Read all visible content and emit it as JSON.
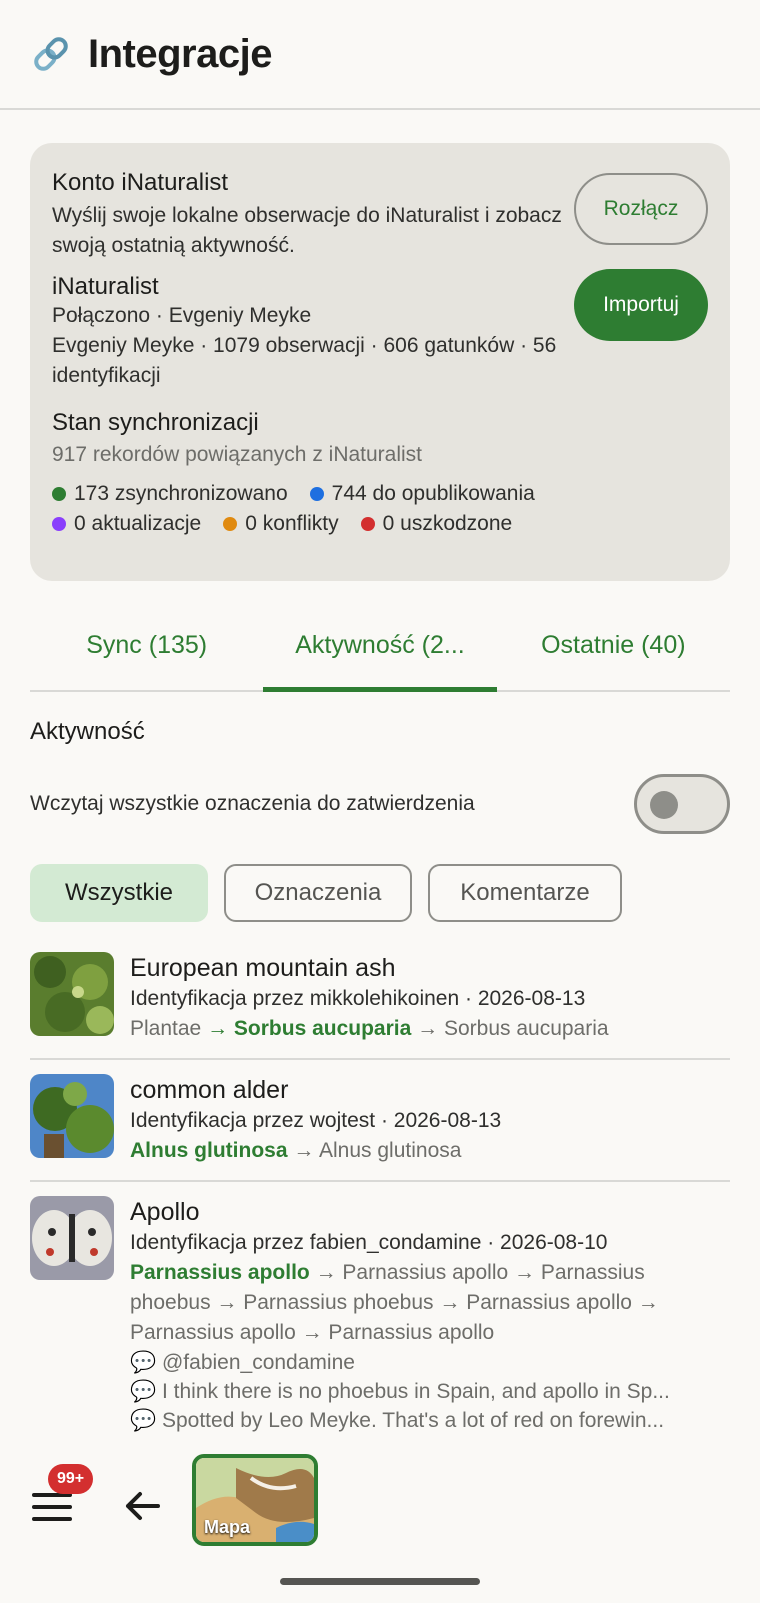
{
  "header": {
    "title": "Integracje",
    "icon": "link-icon"
  },
  "account": {
    "heading": "Konto iNaturalist",
    "description": "Wyślij swoje lokalne obserwacje do iNaturalist i zobacz swoją ostatnią aktywność.",
    "service": "iNaturalist",
    "status": "Połączono · Evgeniy Meyke",
    "stats": "Evgeniy Meyke · 1079 obserwacji · 606 gatunków · 56 identyfikacji",
    "disconnect_label": "Rozłącz",
    "import_label": "Importuj",
    "sync_heading": "Stan synchronizacji",
    "sync_summary": "917 rekordów powiązanych z iNaturalist",
    "legend": [
      {
        "label": "173 zsynchronizowano",
        "color": "#2e7d32"
      },
      {
        "label": "744 do opublikowania",
        "color": "#1e6fe0"
      },
      {
        "label": "0 aktualizacje",
        "color": "#8a3ffc"
      },
      {
        "label": "0 konflikty",
        "color": "#e08a10"
      },
      {
        "label": "0 uszkodzone",
        "color": "#d32f2f"
      }
    ]
  },
  "tabs": [
    {
      "label": "Sync (135)"
    },
    {
      "label": "Aktywność (2..."
    },
    {
      "label": "Ostatnie (40)"
    }
  ],
  "activity": {
    "title": "Aktywność",
    "toggle_label": "Wczytaj wszystkie oznaczenia do zatwierdzenia",
    "chips": [
      "Wszystkie",
      "Oznaczenia",
      "Komentarze"
    ]
  },
  "items": [
    {
      "title": "European mountain ash",
      "subtitle": "Identyfikacja przez mikkolehikoinen · 2026-08-13",
      "p0": "Plantae",
      "arrow1": " → ",
      "hl": "Sorbus aucuparia",
      "rest": " → Sorbus aucuparia"
    },
    {
      "title": "common alder",
      "subtitle": "Identyfikacja przez wojtest · 2026-08-13",
      "hl": "Alnus glutinosa",
      "rest": " → Alnus glutinosa"
    },
    {
      "title": "Apollo",
      "subtitle": "Identyfikacja przez fabien_condamine · 2026-08-10",
      "hl": "Parnassius apollo",
      "rest": " → Parnassius apollo → Parnassius phoebus → Parnassius phoebus → Parnassius apollo → Parnassius apollo → Parnassius apollo",
      "comments": [
        "💬 @fabien_condamine",
        "💬 I think there is no phoebus in Spain, and apollo in Sp...",
        "💬 Spotted by Leo Meyke. That's a lot of red on forewin..."
      ]
    }
  ],
  "bottom": {
    "badge": "99+",
    "map_label": "Mapa"
  }
}
